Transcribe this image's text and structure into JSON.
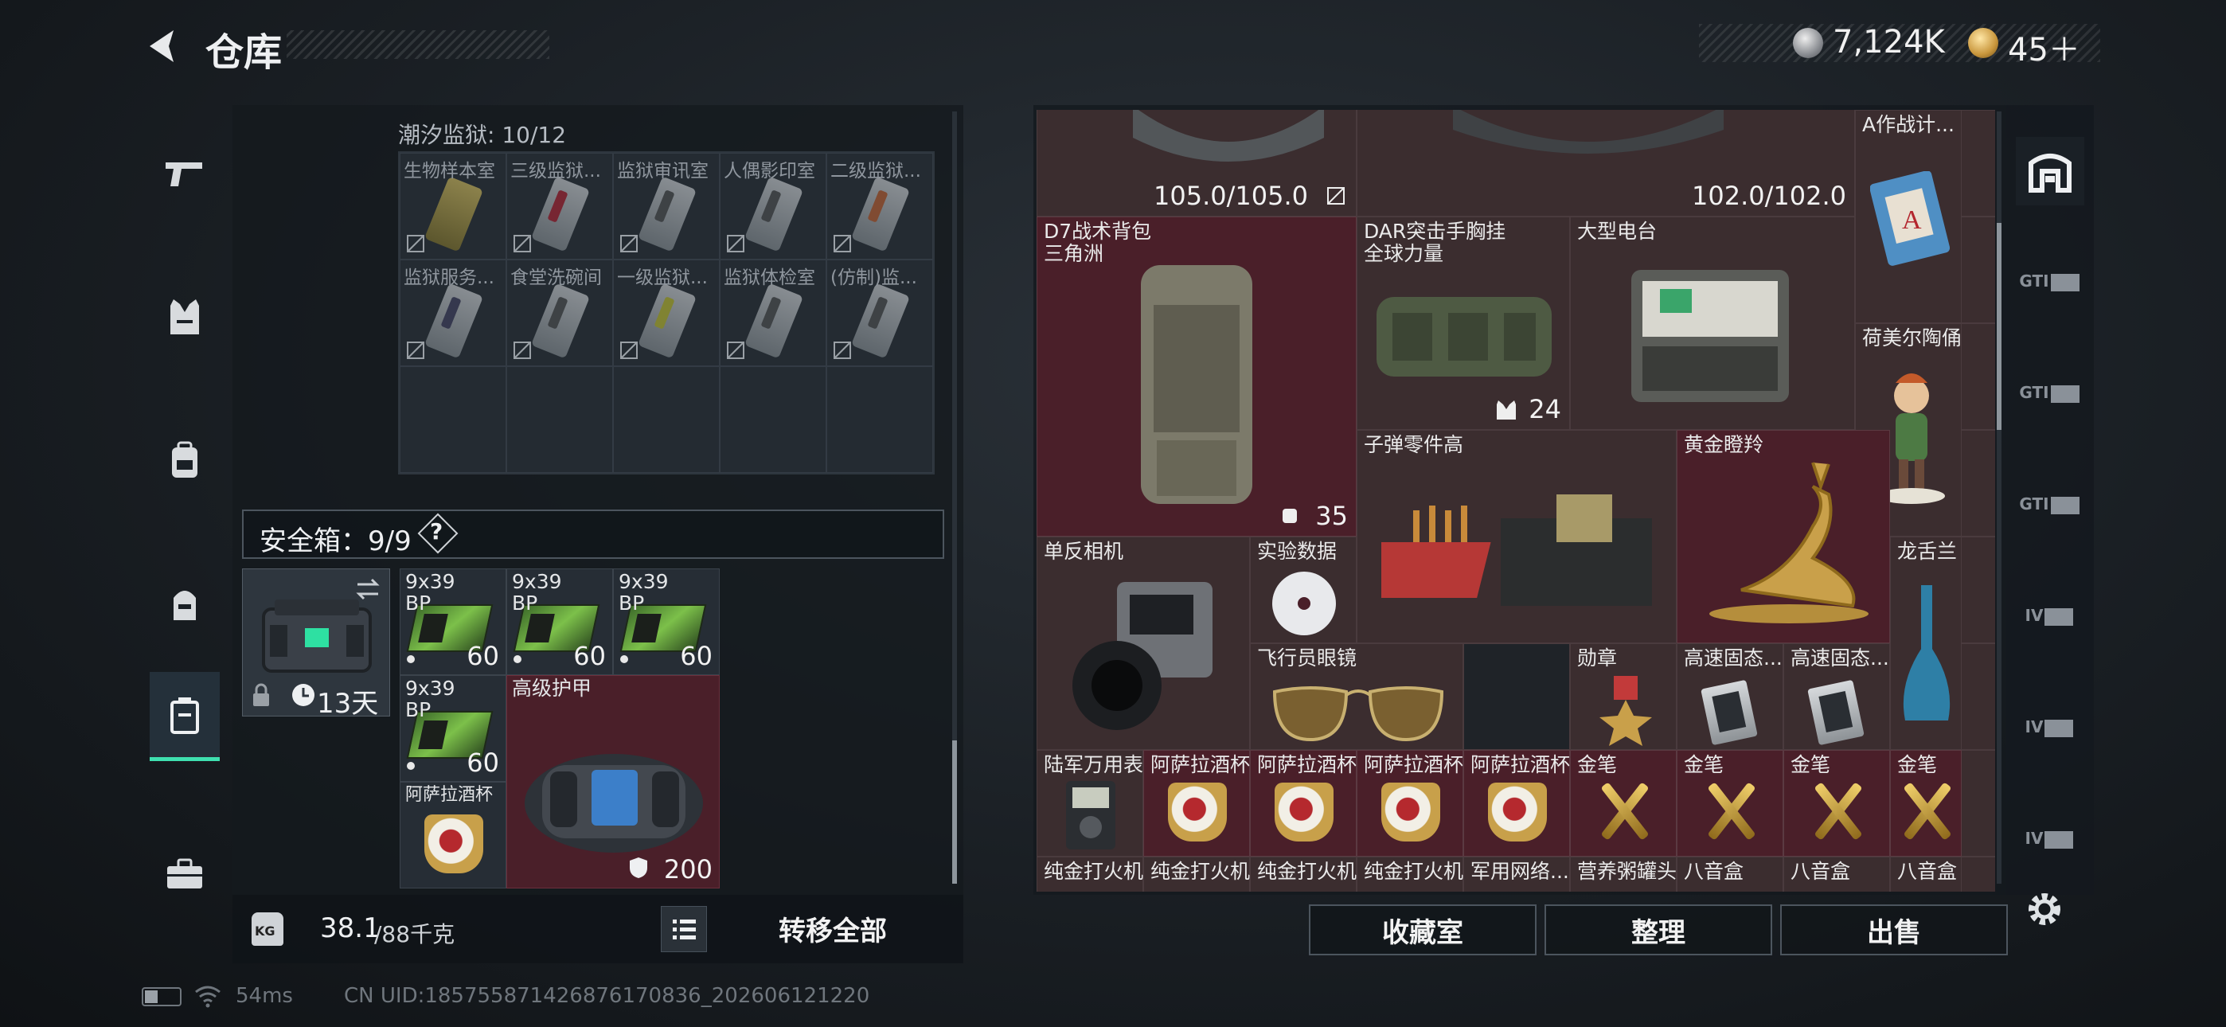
{
  "header": {
    "title": "仓库"
  },
  "currency": [
    {
      "icon": "silver-coin-icon",
      "value": "7,124K"
    },
    {
      "icon": "gold-coin-icon",
      "value": "45＋"
    }
  ],
  "nav": [
    {
      "icon": "pistol-icon"
    },
    {
      "icon": "armor-vest-icon"
    },
    {
      "icon": "backpack-icon"
    },
    {
      "icon": "helmet-bag-icon"
    },
    {
      "icon": "safe-case-icon",
      "selected": true
    },
    {
      "icon": "toolbox-icon"
    }
  ],
  "prison": {
    "label": "潮汐监狱: 10/12",
    "keys": [
      {
        "label": "生物样本室"
      },
      {
        "label": "三级监狱..."
      },
      {
        "label": "监狱审讯室"
      },
      {
        "label": "人偶影印室"
      },
      {
        "label": "二级监狱..."
      },
      {
        "label": "监狱服务..."
      },
      {
        "label": "食堂洗碗间"
      },
      {
        "label": "一级监狱..."
      },
      {
        "label": "监狱体检室"
      },
      {
        "label": "(仿制)监..."
      }
    ]
  },
  "safebox": {
    "label": "安全箱：9/9",
    "help": "?",
    "days": "13天",
    "items": [
      {
        "label": "9x39 BP",
        "count": "60"
      },
      {
        "label": "9x39 BP",
        "count": "60"
      },
      {
        "label": "9x39 BP",
        "count": "60"
      },
      {
        "label": "9x39 BP",
        "count": "60"
      },
      {
        "label": "高级护甲",
        "count": "200"
      },
      {
        "label": "阿萨拉酒杯",
        "count": ""
      }
    ]
  },
  "footer_left": {
    "weight": "38.1",
    "weight_max": "/88千克",
    "kg": "KG",
    "transfer": "转移全部"
  },
  "stash": {
    "top_counts": [
      "105.0/105.0",
      "102.0/102.0"
    ],
    "items": [
      {
        "label": "A作战计..."
      },
      {
        "label": "D7战术背包\n三角洲",
        "count": "35"
      },
      {
        "label": "DAR突击手胸挂\n全球力量",
        "count": "24"
      },
      {
        "label": "大型电台"
      },
      {
        "label": "荷美尔陶俑"
      },
      {
        "label": "子弹零件高"
      },
      {
        "label": "黄金瞪羚"
      },
      {
        "label": "单反相机"
      },
      {
        "label": "实验数据"
      },
      {
        "label": "龙舌兰"
      },
      {
        "label": "飞行员眼镜"
      },
      {
        "label": "勋章"
      },
      {
        "label": "高速固态..."
      },
      {
        "label": "高速固态..."
      },
      {
        "label": "陆军万用表"
      },
      {
        "label": "阿萨拉酒杯"
      },
      {
        "label": "阿萨拉酒杯"
      },
      {
        "label": "阿萨拉酒杯"
      },
      {
        "label": "阿萨拉酒杯"
      },
      {
        "label": "金笔"
      },
      {
        "label": "金笔"
      },
      {
        "label": "金笔"
      },
      {
        "label": "金笔"
      },
      {
        "label": "纯金打火机"
      },
      {
        "label": "纯金打火机"
      },
      {
        "label": "纯金打火机"
      },
      {
        "label": "纯金打火机"
      },
      {
        "label": "军用网络..."
      },
      {
        "label": "营养粥罐头"
      },
      {
        "label": "八音盒"
      },
      {
        "label": "八音盒"
      },
      {
        "label": "八音盒"
      }
    ]
  },
  "right_tabs": [
    "GTI",
    "GTI",
    "GTI",
    "IV",
    "IV",
    "IV"
  ],
  "bottom_buttons": {
    "collection": "收藏室",
    "sort": "整理",
    "sell": "出售"
  },
  "status": {
    "ping": "54ms",
    "uid": "CN UID:1857558714268761708​36_202606121220"
  },
  "colors": {
    "accent": "#3fe0b0",
    "red_cell": "#4a1f29"
  }
}
